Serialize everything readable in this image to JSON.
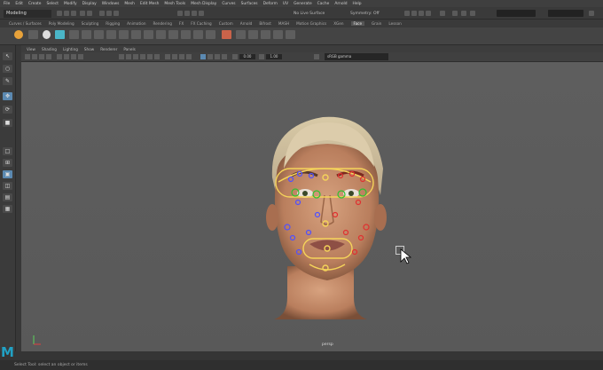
{
  "menubar": [
    "File",
    "Edit",
    "Create",
    "Select",
    "Modify",
    "Display",
    "Windows",
    "Mesh",
    "Edit Mesh",
    "Mesh Tools",
    "Mesh Display",
    "Curves",
    "Surfaces",
    "Deform",
    "UV",
    "Generate",
    "Cache",
    "Arnold",
    "Help"
  ],
  "status": {
    "workspace": "Modeling",
    "live_surface": "No Live Surface",
    "symmetry": "Symmetry: Off"
  },
  "shelf_tabs": [
    "Curves / Surfaces",
    "Poly Modeling",
    "Sculpting",
    "Rigging",
    "Animation",
    "Rendering",
    "FX",
    "FX Caching",
    "Custom",
    "Arnold",
    "Bifrost",
    "MASH",
    "Motion Graphics",
    "XGen",
    "Face",
    "Grain",
    "Lesson"
  ],
  "active_shelf_tab": "Face",
  "viewport_menu": [
    "View",
    "Shading",
    "Lighting",
    "Show",
    "Renderer",
    "Panels"
  ],
  "viewport_fields": {
    "near": "0.00",
    "far": "1.00",
    "color_space": "sRGB gamma"
  },
  "camera_name": "persp",
  "help_line": "Select Tool: select an object or items",
  "colors": {
    "accent": "#5b89b1",
    "maya_logo": "#21a1c4",
    "control_yellow": "#f5d45a"
  }
}
